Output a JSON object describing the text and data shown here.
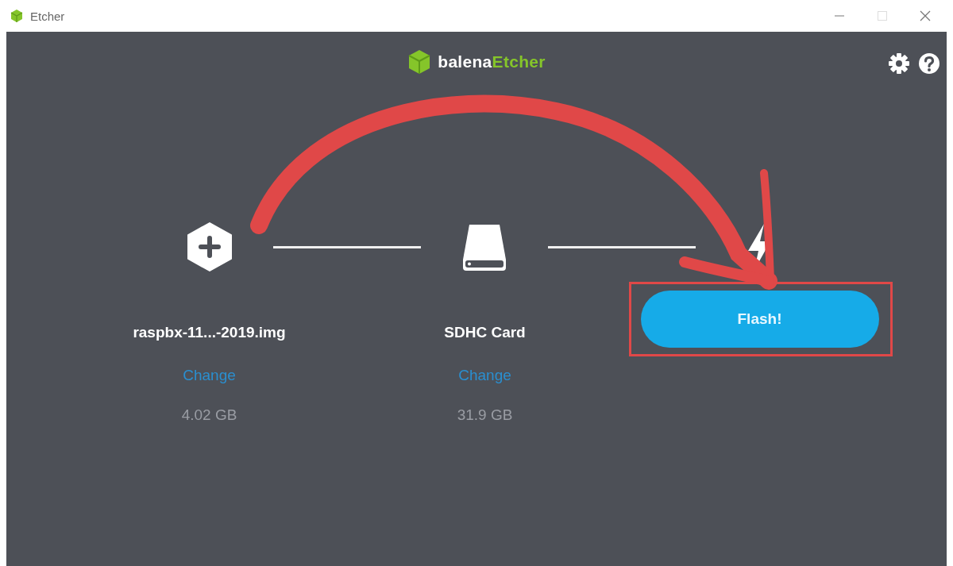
{
  "window": {
    "title": "Etcher"
  },
  "logo": {
    "prefix": "balena",
    "suffix": "Etcher"
  },
  "steps": [
    {
      "kind": "image",
      "name": "raspbx-11...-2019.img",
      "action": "Change",
      "size": "4.02 GB"
    },
    {
      "kind": "drive",
      "name": "SDHC Card",
      "action": "Change",
      "size": "31.9 GB"
    },
    {
      "kind": "flash",
      "button": "Flash!",
      "highlighted": true
    }
  ],
  "annotation": {
    "arrow": true
  }
}
